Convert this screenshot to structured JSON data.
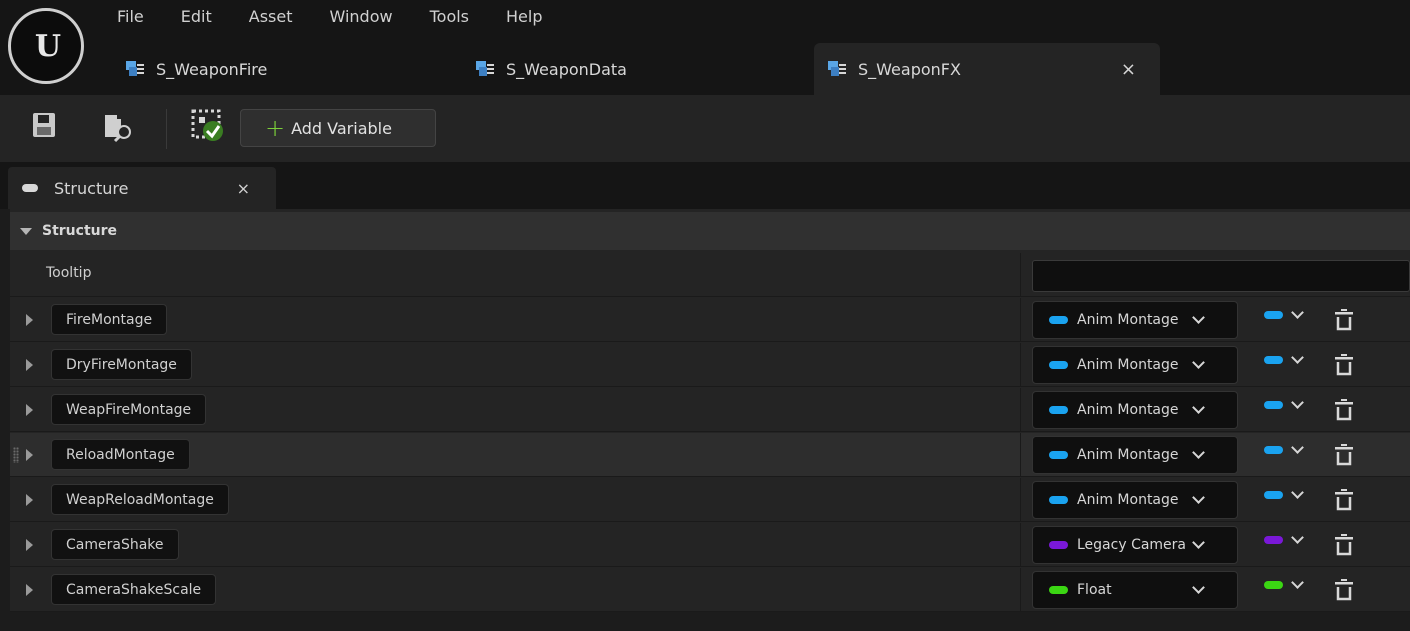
{
  "menu": [
    "File",
    "Edit",
    "Asset",
    "Window",
    "Tools",
    "Help"
  ],
  "tabs": [
    {
      "label": "S_WeaponFire"
    },
    {
      "label": "S_WeaponData"
    },
    {
      "label": "S_WeaponFX",
      "close": "×"
    }
  ],
  "toolbar": {
    "save_icon": "save-icon",
    "browse_icon": "browse-icon",
    "validate_icon": "validate-icon",
    "add_variable_plus": "+",
    "add_variable_label": "Add Variable"
  },
  "panel": {
    "tab_label": "Structure",
    "tab_close": "×",
    "category": "Structure",
    "tooltip_label": "Tooltip",
    "tooltip_value": ""
  },
  "colors": {
    "anim_montage": "#1aa3f0",
    "legacy_camera": "#7a18d8",
    "float": "#3bd613",
    "accent_plus": "#7ccf3a"
  },
  "members": [
    {
      "name": "FireMontage",
      "type": "Anim Montage",
      "type_color": "#1aa3f0"
    },
    {
      "name": "DryFireMontage",
      "type": "Anim Montage",
      "type_color": "#1aa3f0"
    },
    {
      "name": "WeapFireMontage",
      "type": "Anim Montage",
      "type_color": "#1aa3f0"
    },
    {
      "name": "ReloadMontage",
      "type": "Anim Montage",
      "type_color": "#1aa3f0"
    },
    {
      "name": "WeapReloadMontage",
      "type": "Anim Montage",
      "type_color": "#1aa3f0"
    },
    {
      "name": "CameraShake",
      "type": "Legacy Camera Shake",
      "type_color": "#7a18d8"
    },
    {
      "name": "CameraShakeScale",
      "type": "Float",
      "type_color": "#3bd613"
    }
  ]
}
